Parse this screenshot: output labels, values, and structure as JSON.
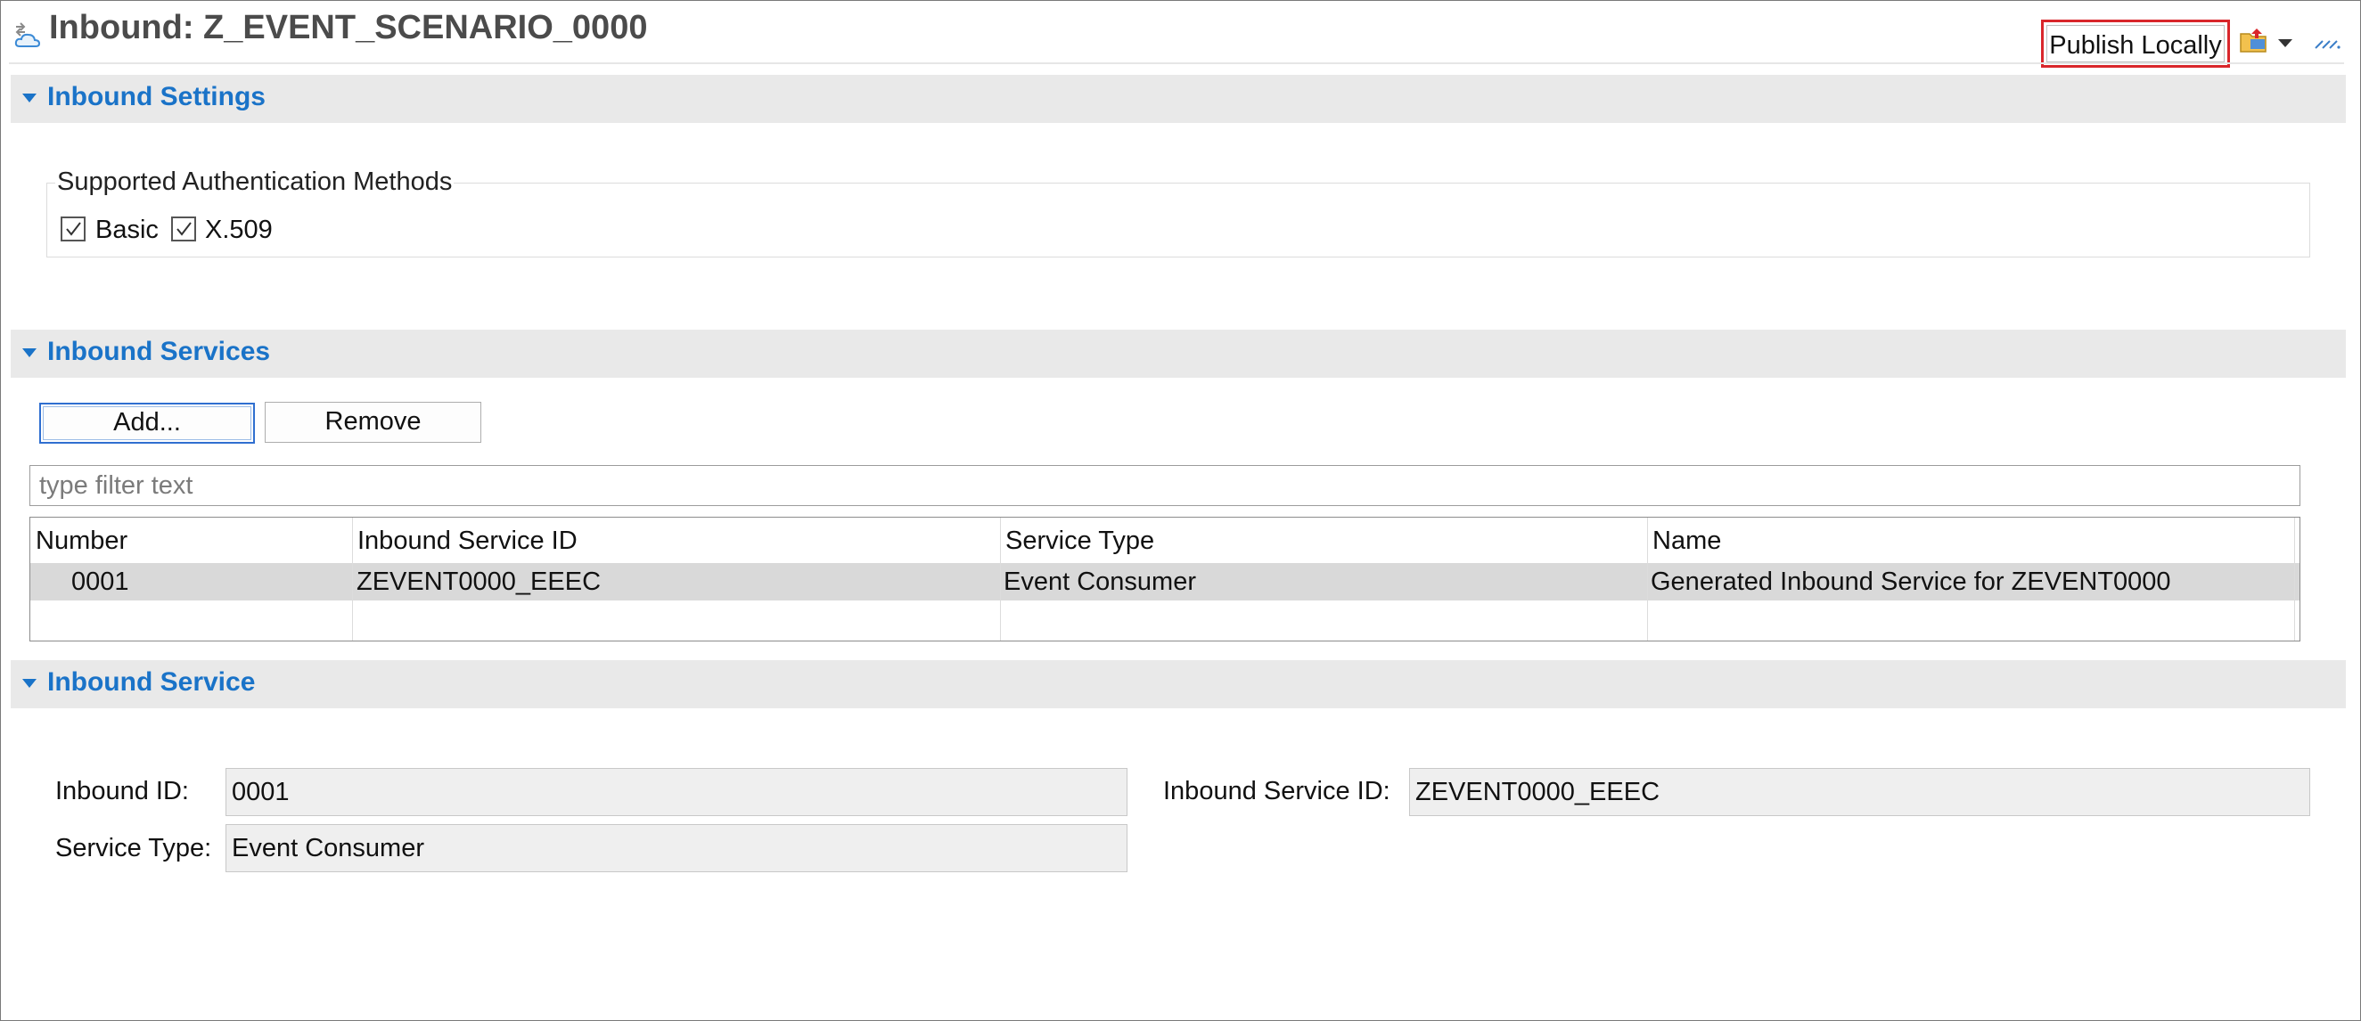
{
  "header": {
    "title": "Inbound: Z_EVENT_SCENARIO_0000",
    "publish_label": "Publish Locally",
    "title_icon": "inbound-cloud-icon",
    "toolbar_icons": [
      "publish-folder-icon",
      "dropdown-arrow-icon",
      "resize-grip-icon"
    ]
  },
  "sections": {
    "settings": {
      "title": "Inbound Settings"
    },
    "services": {
      "title": "Inbound Services"
    },
    "service": {
      "title": "Inbound Service"
    }
  },
  "auth": {
    "legend": "Supported Authentication Methods",
    "methods": [
      {
        "label": "Basic",
        "checked": true
      },
      {
        "label": "X.509",
        "checked": true
      }
    ]
  },
  "services_toolbar": {
    "add_label": "Add...",
    "remove_label": "Remove",
    "filter_placeholder": "type filter text"
  },
  "table": {
    "columns": [
      "Number",
      "Inbound Service ID",
      "Service Type",
      "Name"
    ],
    "rows": [
      [
        "0001",
        "ZEVENT0000_EEEC",
        "Event Consumer",
        "Generated Inbound Service for ZEVENT0000"
      ]
    ]
  },
  "detail": {
    "inbound_id_label": "Inbound ID:",
    "inbound_id_value": "0001",
    "service_type_label": "Service Type:",
    "service_type_value": "Event Consumer",
    "inbound_service_id_label": "Inbound Service ID:",
    "inbound_service_id_value": "ZEVENT0000_EEEC"
  },
  "colors": {
    "section_title": "#1a73c8",
    "highlight_border": "#d9262b",
    "selected_row": "#d9d9d9"
  }
}
